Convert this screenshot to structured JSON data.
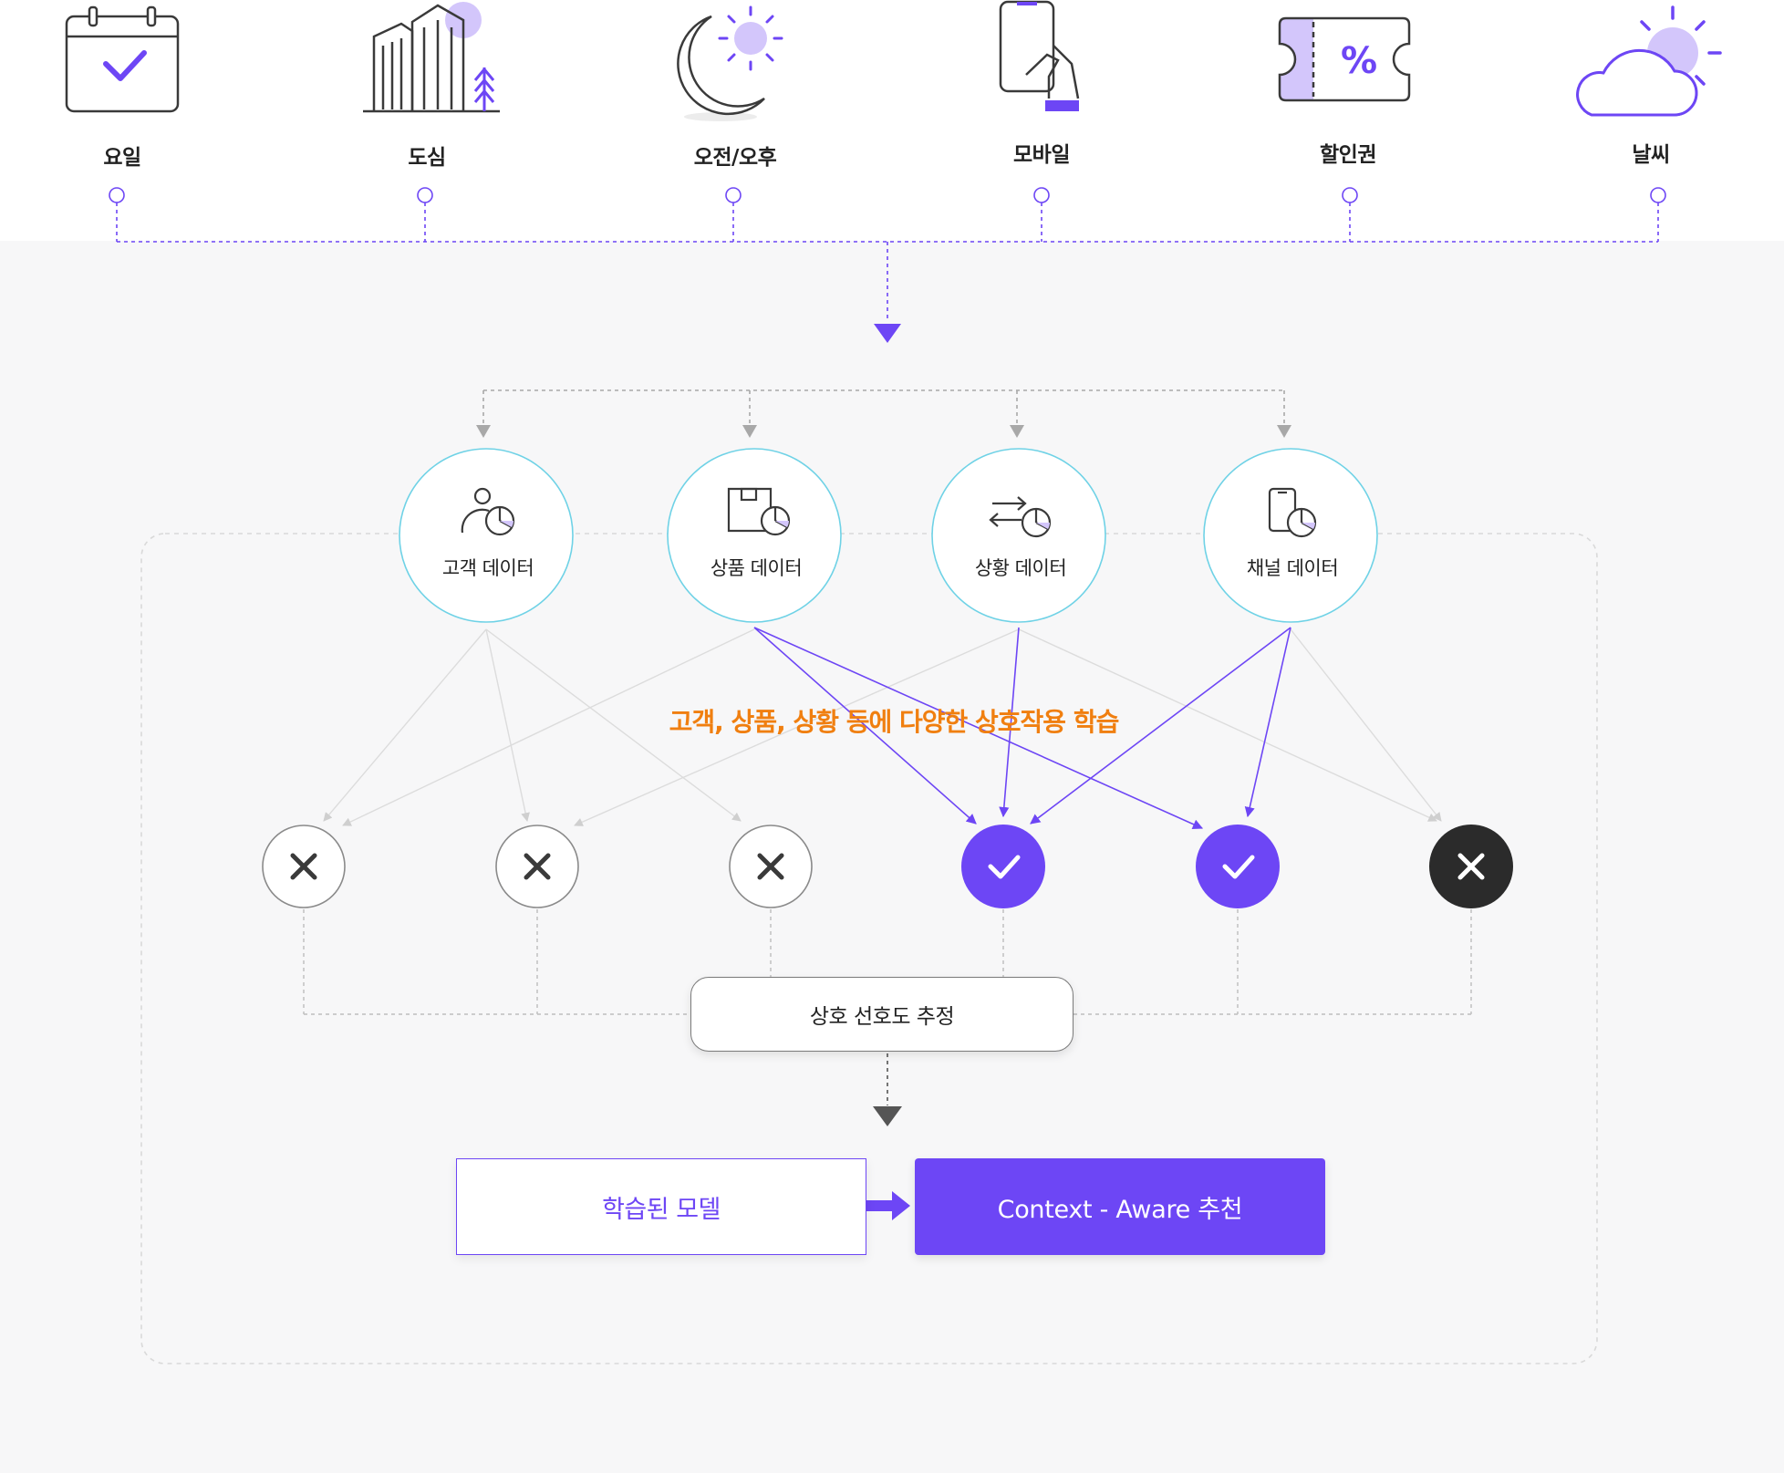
{
  "colors": {
    "accent": "#6d46f5",
    "accent_light": "#d3c6fb",
    "caption_orange": "#f07f10",
    "node_border": "#6fd2e6",
    "icon_dark": "#3a3a3a",
    "result_dark": "#2b2b2b"
  },
  "context_factors": [
    {
      "label": "요일",
      "icon": "calendar-check-icon"
    },
    {
      "label": "도심",
      "icon": "city-buildings-icon"
    },
    {
      "label": "오전/오후",
      "icon": "moon-sun-icon"
    },
    {
      "label": "모바일",
      "icon": "mobile-hand-icon"
    },
    {
      "label": "할인권",
      "icon": "discount-coupon-icon"
    },
    {
      "label": "날씨",
      "icon": "cloud-sun-icon"
    }
  ],
  "data_nodes": [
    {
      "label": "고객 데이터",
      "icon": "customer-chart-icon"
    },
    {
      "label": "상품 데이터",
      "icon": "product-box-chart-icon"
    },
    {
      "label": "상황 데이터",
      "icon": "exchange-arrows-chart-icon"
    },
    {
      "label": "채널 데이터",
      "icon": "mobile-chart-icon"
    }
  ],
  "interaction_caption": "고객, 상품, 상황 등에 다양한 상호작용 학습",
  "results": [
    {
      "state": "rejected",
      "icon": "x-icon"
    },
    {
      "state": "rejected",
      "icon": "x-icon"
    },
    {
      "state": "rejected",
      "icon": "x-icon"
    },
    {
      "state": "selected",
      "icon": "check-icon"
    },
    {
      "state": "selected",
      "icon": "check-icon"
    },
    {
      "state": "rejected-dark",
      "icon": "x-icon"
    }
  ],
  "estimate_label": "상호 선호도 추정",
  "model_label": "학습된 모델",
  "recommendation_label": "Context - Aware 추천"
}
